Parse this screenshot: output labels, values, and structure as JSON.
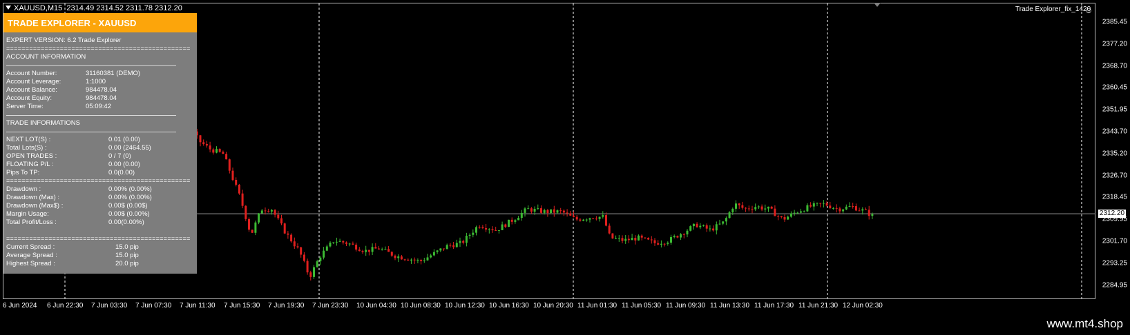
{
  "symbol_bar": {
    "symbol_timeframe": "XAUUSD,M15",
    "ohlc": "2314.49 2314.52 2311.78 2312.20"
  },
  "indicator_label": "Trade Explorer_fix_1420",
  "colors": {
    "bull": "#3cba33",
    "bear": "#e0201e",
    "panel_header": "#fca50b",
    "panel_bg": "#7d7d7d",
    "grid": "#ffffff"
  },
  "price_axis": {
    "labels": [
      "2385.45",
      "2377.20",
      "2368.70",
      "2360.45",
      "2351.95",
      "2343.70",
      "2335.20",
      "2326.70",
      "2318.45",
      "2309.95",
      "2301.70",
      "2293.25",
      "2284.95"
    ],
    "current_price": "2312.20"
  },
  "time_axis": {
    "labels": [
      "6 Jun 2024",
      "6 Jun 22:30",
      "7 Jun 03:30",
      "7 Jun 07:30",
      "7 Jun 11:30",
      "7 Jun 15:30",
      "7 Jun 19:30",
      "7 Jun 23:30",
      "10 Jun 04:30",
      "10 Jun 08:30",
      "10 Jun 12:30",
      "10 Jun 16:30",
      "10 Jun 20:30",
      "11 Jun 01:30",
      "11 Jun 05:30",
      "11 Jun 09:30",
      "11 Jun 13:30",
      "11 Jun 17:30",
      "11 Jun 21:30",
      "12 Jun 02:30"
    ]
  },
  "panel": {
    "title": "TRADE EXPLORER - XAUUSD",
    "expert_version": "EXPERT VERSION: 6.2 Trade Explorer",
    "eq_sep": "================================================",
    "account_header": "ACCOUNT INFORMATION",
    "account": [
      {
        "label": "Account Number:",
        "value": "31160381 (DEMO)"
      },
      {
        "label": "Account Leverage:",
        "value": "1:1000"
      },
      {
        "label": "Account Balance:",
        "value": "984478.04"
      },
      {
        "label": "Account Equity:",
        "value": "984478.04"
      },
      {
        "label": "Server Time:",
        "value": "05:09:42"
      }
    ],
    "trade_header": "TRADE INFORMATIONS",
    "trade": [
      {
        "label": "NEXT LOT(S) :",
        "value": "0.01 (0.00)"
      },
      {
        "label": "Total Lots(S) :",
        "value": "0.00 (2464.55)"
      },
      {
        "label": "OPEN TRADES :",
        "value": "0 / 7 (0)"
      },
      {
        "label": "FLOATING P/L :",
        "value": "0.00 (0.00)"
      },
      {
        "label": "Pips To TP:",
        "value": "0.0(0.00)"
      }
    ],
    "drawdown": [
      {
        "label": "Drawdown :",
        "value": "0.00% (0.00%)"
      },
      {
        "label": "Drawdown (Max) :",
        "value": "0.00% (0.00%)"
      },
      {
        "label": "Drawdown (Max$) :",
        "value": "0.00$ (0.00$)"
      },
      {
        "label": "Margin Usage:",
        "value": "0.00$ (0.00%)"
      },
      {
        "label": "Total Profit/Loss :",
        "value": "0.00(0.00%)"
      }
    ],
    "spread": [
      {
        "label": "Current Spread :",
        "value": "15.0 pip"
      },
      {
        "label": "Average Spread :",
        "value": "15.0 pip"
      },
      {
        "label": "Highest Spread :",
        "value": "20.0 pip"
      }
    ]
  },
  "watermark": "www.mt4.shop"
}
